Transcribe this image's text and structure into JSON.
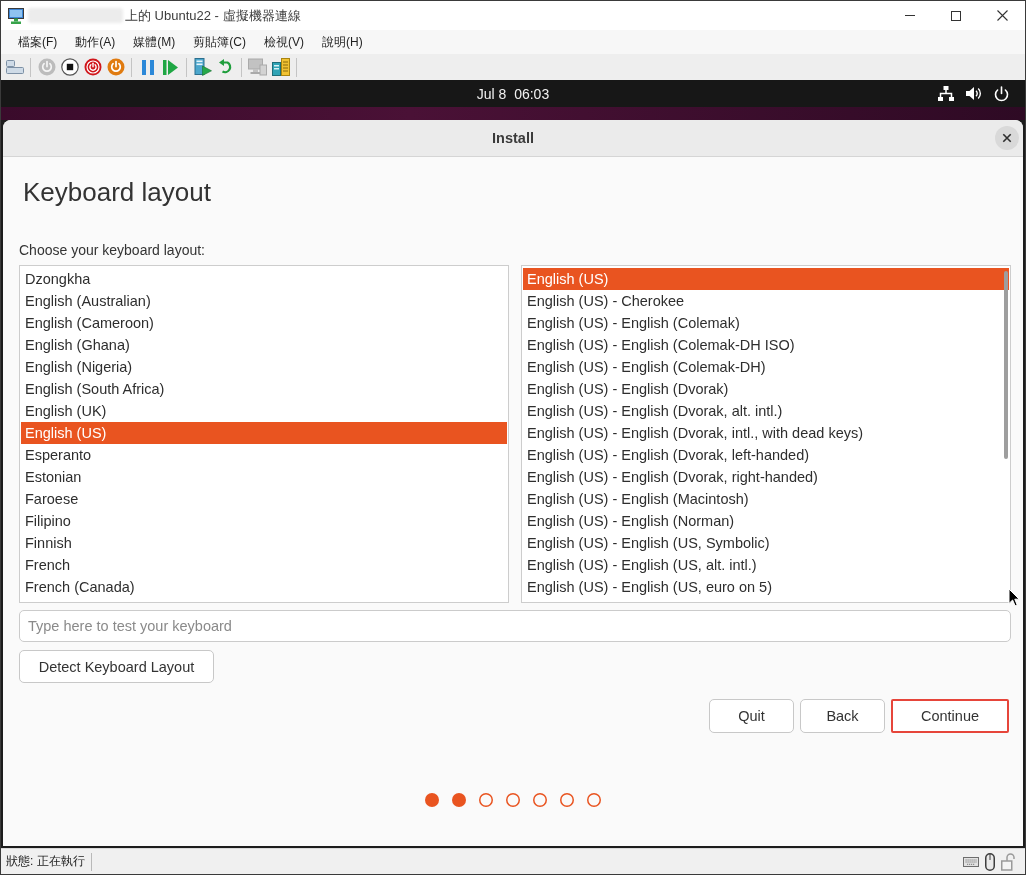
{
  "window": {
    "title": "上的 Ubuntu22 - 虛擬機器連線"
  },
  "menu": [
    "檔案(F)",
    "動作(A)",
    "媒體(M)",
    "剪貼簿(C)",
    "檢視(V)",
    "說明(H)"
  ],
  "toolbar": {
    "groups": [
      [
        {
          "disabled": false
        }
      ],
      [
        {
          "disabled": true
        },
        {
          "disabled": false
        },
        {
          "disabled": false
        },
        {
          "disabled": false
        }
      ],
      [
        {
          "disabled": false
        },
        {
          "disabled": false
        }
      ],
      [
        {
          "disabled": false
        },
        {
          "disabled": false
        }
      ],
      [
        {
          "disabled": true
        },
        {
          "disabled": false
        }
      ]
    ]
  },
  "vm_top_bar": {
    "clock": "Jul 8  06:03"
  },
  "dialog": {
    "title": "Install",
    "heading": "Keyboard layout",
    "prompt": "Choose your keyboard layout:",
    "layouts": [
      {
        "label": "Dzongkha",
        "selected": false
      },
      {
        "label": "English (Australian)",
        "selected": false
      },
      {
        "label": "English (Cameroon)",
        "selected": false
      },
      {
        "label": "English (Ghana)",
        "selected": false
      },
      {
        "label": "English (Nigeria)",
        "selected": false
      },
      {
        "label": "English (South Africa)",
        "selected": false
      },
      {
        "label": "English (UK)",
        "selected": false
      },
      {
        "label": "English (US)",
        "selected": true
      },
      {
        "label": "Esperanto",
        "selected": false
      },
      {
        "label": "Estonian",
        "selected": false
      },
      {
        "label": "Faroese",
        "selected": false
      },
      {
        "label": "Filipino",
        "selected": false
      },
      {
        "label": "Finnish",
        "selected": false
      },
      {
        "label": "French",
        "selected": false
      },
      {
        "label": "French (Canada)",
        "selected": false
      }
    ],
    "variants": [
      {
        "label": "English (US)",
        "selected": true
      },
      {
        "label": "English (US) - Cherokee",
        "selected": false
      },
      {
        "label": "English (US) - English (Colemak)",
        "selected": false
      },
      {
        "label": "English (US) - English (Colemak-DH ISO)",
        "selected": false
      },
      {
        "label": "English (US) - English (Colemak-DH)",
        "selected": false
      },
      {
        "label": "English (US) - English (Dvorak)",
        "selected": false
      },
      {
        "label": "English (US) - English (Dvorak, alt. intl.)",
        "selected": false
      },
      {
        "label": "English (US) - English (Dvorak, intl., with dead keys)",
        "selected": false
      },
      {
        "label": "English (US) - English (Dvorak, left-handed)",
        "selected": false
      },
      {
        "label": "English (US) - English (Dvorak, right-handed)",
        "selected": false
      },
      {
        "label": "English (US) - English (Macintosh)",
        "selected": false
      },
      {
        "label": "English (US) - English (Norman)",
        "selected": false
      },
      {
        "label": "English (US) - English (US, Symbolic)",
        "selected": false
      },
      {
        "label": "English (US) - English (US, alt. intl.)",
        "selected": false
      },
      {
        "label": "English (US) - English (US, euro on 5)",
        "selected": false
      }
    ],
    "test_field": {
      "placeholder": "Type here to test your keyboard"
    },
    "detect_button": "Detect Keyboard Layout",
    "buttons": [
      {
        "label": "Quit",
        "outlined": false
      },
      {
        "label": "Back",
        "outlined": false
      },
      {
        "label": "Continue",
        "outlined": true
      }
    ],
    "steps": [
      {
        "filled": true
      },
      {
        "filled": true
      },
      {
        "filled": false
      },
      {
        "filled": false
      },
      {
        "filled": false
      },
      {
        "filled": false
      },
      {
        "filled": false
      }
    ]
  },
  "status_bar": {
    "text": "狀態: 正在執行"
  }
}
